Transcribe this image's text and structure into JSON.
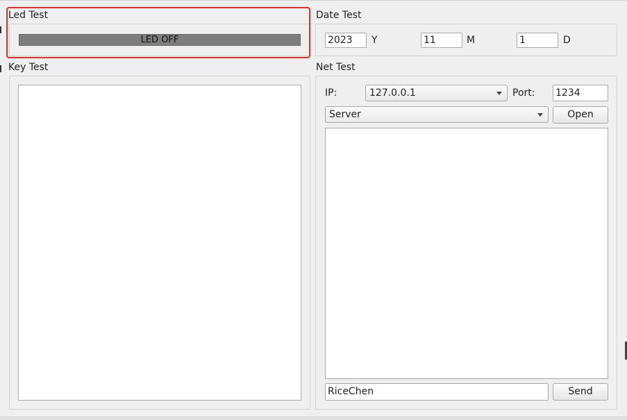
{
  "led_group": {
    "title": "Led Test",
    "led_label": "LED OFF"
  },
  "date_group": {
    "title": "Date Test",
    "year_value": "2023",
    "year_unit": "Y",
    "month_value": "11",
    "month_unit": "M",
    "day_value": "1",
    "day_unit": "D"
  },
  "key_group": {
    "title": "Key Test"
  },
  "net_group": {
    "title": "Net Test",
    "ip_label": "IP:",
    "ip_value": "127.0.0.1",
    "port_label": "Port:",
    "port_value": "1234",
    "mode_value": "Server",
    "open_label": "Open",
    "send_input_value": "RiceChen",
    "send_label": "Send"
  },
  "colors": {
    "highlight": "#e0302a",
    "led_off": "#7d7d7d",
    "background": "#efefef"
  }
}
